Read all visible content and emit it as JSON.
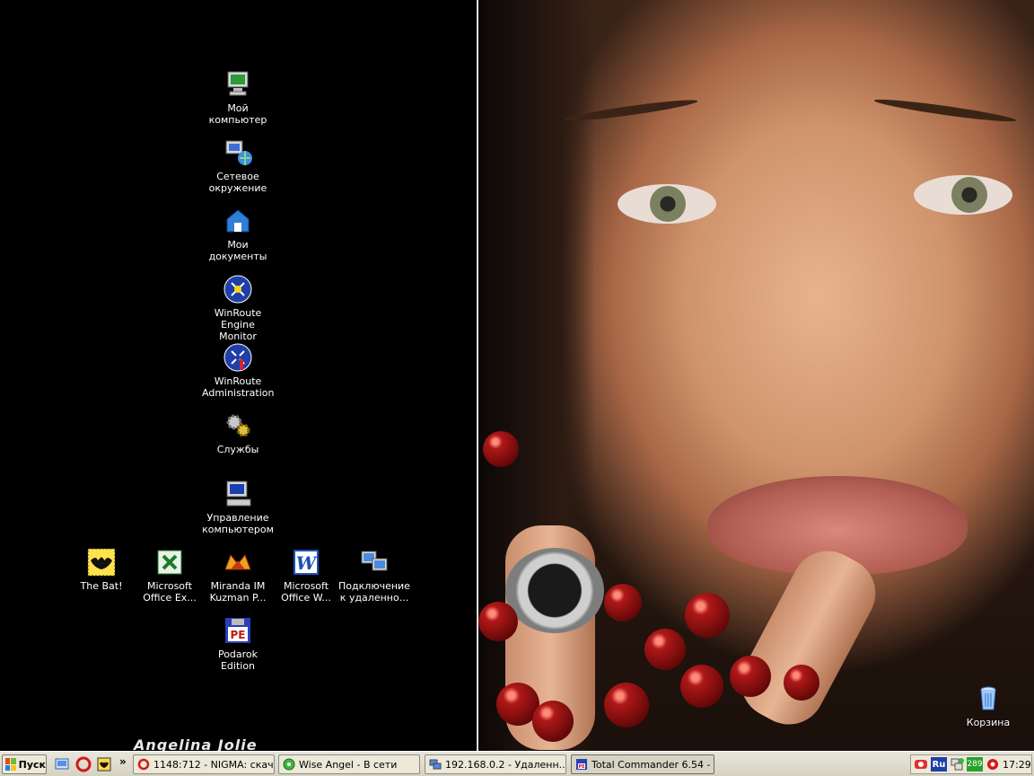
{
  "desktop": {
    "wallpaper_caption": "Angelina Jolie",
    "icons": [
      {
        "label": "Мой\nкомпьютер",
        "icon": "my-computer-icon"
      },
      {
        "label": "Сетевое\nокружение",
        "icon": "network-icon"
      },
      {
        "label": "Мои\nдокументы",
        "icon": "my-documents-icon"
      },
      {
        "label": "WinRoute\nEngine Monitor",
        "icon": "winroute-monitor-icon"
      },
      {
        "label": "WinRoute\nAdministration",
        "icon": "winroute-admin-icon"
      },
      {
        "label": "Службы",
        "icon": "services-icon"
      },
      {
        "label": "Управление\nкомпьютером",
        "icon": "computer-management-icon"
      },
      {
        "label": "The Bat!",
        "icon": "the-bat-icon"
      },
      {
        "label": "Microsoft\nOffice Ex...",
        "icon": "excel-icon"
      },
      {
        "label": "Miranda IM\nKuzman P...",
        "icon": "miranda-icon"
      },
      {
        "label": "Microsoft\nOffice W...",
        "icon": "word-icon"
      },
      {
        "label": "Подключение\nк удаленно...",
        "icon": "remote-desktop-icon"
      },
      {
        "label": "Podarok\nEdition",
        "icon": "pe-icon"
      },
      {
        "label": "Корзина",
        "icon": "recycle-bin-icon"
      }
    ]
  },
  "taskbar": {
    "start_label": "Пуск",
    "quick_launch": [
      "show-desktop-icon",
      "opera-icon",
      "the-bat-small-icon"
    ],
    "more_label": "»",
    "tasks": [
      {
        "label": "1148:712 - NIGMA: скач...",
        "icon": "opera-icon"
      },
      {
        "label": "Wise Angel - В сети",
        "icon": "miranda-icon"
      },
      {
        "label": "192.168.0.2 - Удаленн...",
        "icon": "remote-desktop-icon"
      },
      {
        "label": "Total Commander 6.54 - ...",
        "icon": "total-commander-icon"
      }
    ],
    "tray": {
      "language": "Ru",
      "counter": "289",
      "time": "17:29"
    }
  },
  "colors": {
    "taskbar_bg": "#d6d2c2",
    "desktop_bg": "#000000"
  }
}
